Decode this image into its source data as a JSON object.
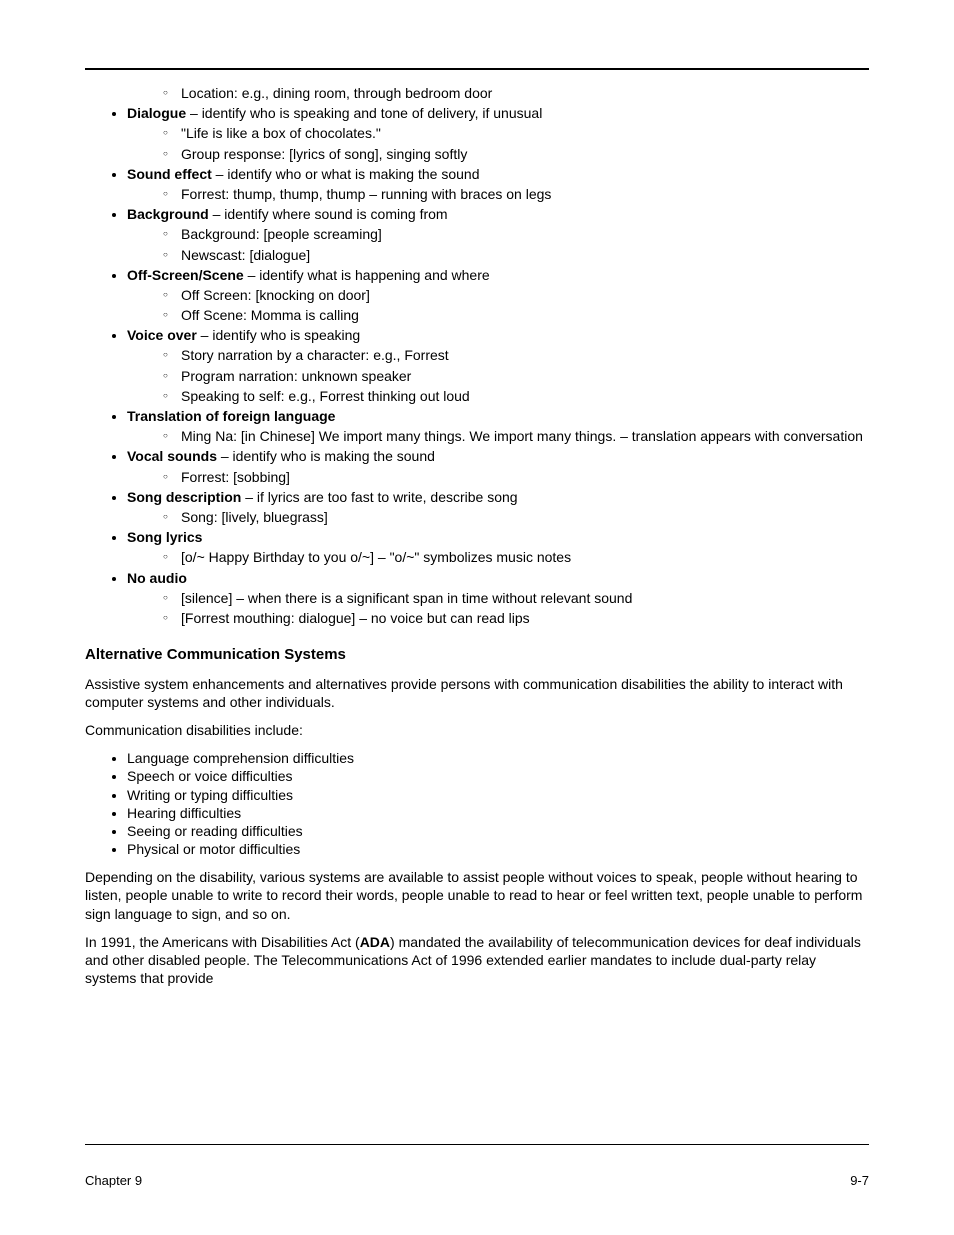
{
  "preceding_sub": "Location: e.g., dining room, through bedroom door",
  "bullets": [
    {
      "label": "Dialogue",
      "sep": " – ",
      "desc": "identify who is speaking and tone of delivery, if unusual",
      "subs": [
        "\"Life is like a box of chocolates.\"",
        "Group response: [lyrics of song], singing softly"
      ]
    },
    {
      "label": "Sound effect",
      "sep": " – ",
      "desc": "identify who or what is making the sound",
      "subs": [
        "Forrest: thump, thump, thump – running with braces on legs"
      ]
    },
    {
      "label": "Background",
      "sep": " – ",
      "desc": "identify where sound is coming from",
      "subs": [
        "Background: [people screaming]",
        "Newscast: [dialogue]"
      ]
    },
    {
      "label": "Off-Screen/Scene",
      "sep": " – ",
      "desc": "identify what is happening and where",
      "subs": [
        "Off Screen: [knocking on door]",
        "Off Scene: Momma is calling"
      ]
    },
    {
      "label": "Voice over",
      "sep": " – ",
      "desc": "identify who is speaking",
      "subs": [
        "Story narration by a character: e.g., Forrest",
        "Program narration: unknown speaker",
        "Speaking to self: e.g., Forrest thinking out loud"
      ]
    },
    {
      "label": "Translation of foreign language",
      "sep": "",
      "desc": "",
      "subs": [
        "Ming Na: [in Chinese] We import many things. We import many things. – translation appears with conversation"
      ]
    },
    {
      "label": "Vocal sounds",
      "sep": " – ",
      "desc": "identify who is making the sound",
      "subs": [
        "Forrest: [sobbing]"
      ]
    },
    {
      "label": "Song description",
      "sep": " – ",
      "desc": "if lyrics are too fast to write, describe song",
      "subs": [
        "Song: [lively, bluegrass]"
      ]
    },
    {
      "label": "Song lyrics",
      "sep": "",
      "desc": "",
      "subs": [
        "[o/~ Happy Birthday to you o/~] – \"o/~\" symbolizes music notes"
      ]
    },
    {
      "label": "No audio",
      "sep": "",
      "desc": "",
      "subs": [
        "[silence] – when there is a significant span in time without relevant sound",
        "[Forrest mouthing: dialogue] – no voice but can read lips"
      ]
    }
  ],
  "section_heading": "Alternative Communication Systems",
  "para1": "Assistive system enhancements and alternatives provide persons with communication disabilities the ability to interact with computer systems and other individuals.",
  "comm_disabilities_label": "Communication disabilities include:",
  "comm_disabilities": [
    "Language comprehension difficulties",
    "Speech or voice difficulties",
    "Writing or typing difficulties",
    "Hearing difficulties",
    "Seeing or reading difficulties",
    "Physical or motor difficulties"
  ],
  "para2": "Depending on the disability, various systems are available to assist people without voices to speak, people without hearing to listen, people unable to write to record their words, people unable to read to hear or feel written text, people unable to perform sign language to sign, and so on.",
  "para3_prefix": "In 1991, the Americans with Disabilities Act (",
  "para3_bold": "ADA",
  "para3_suffix": ") mandated the availability of telecommunication devices for deaf individuals and other disabled people. The Telecommunications Act of 1996 extended earlier mandates to include dual-party relay systems that provide",
  "footer_left": "Chapter 9",
  "footer_right": "9-7"
}
